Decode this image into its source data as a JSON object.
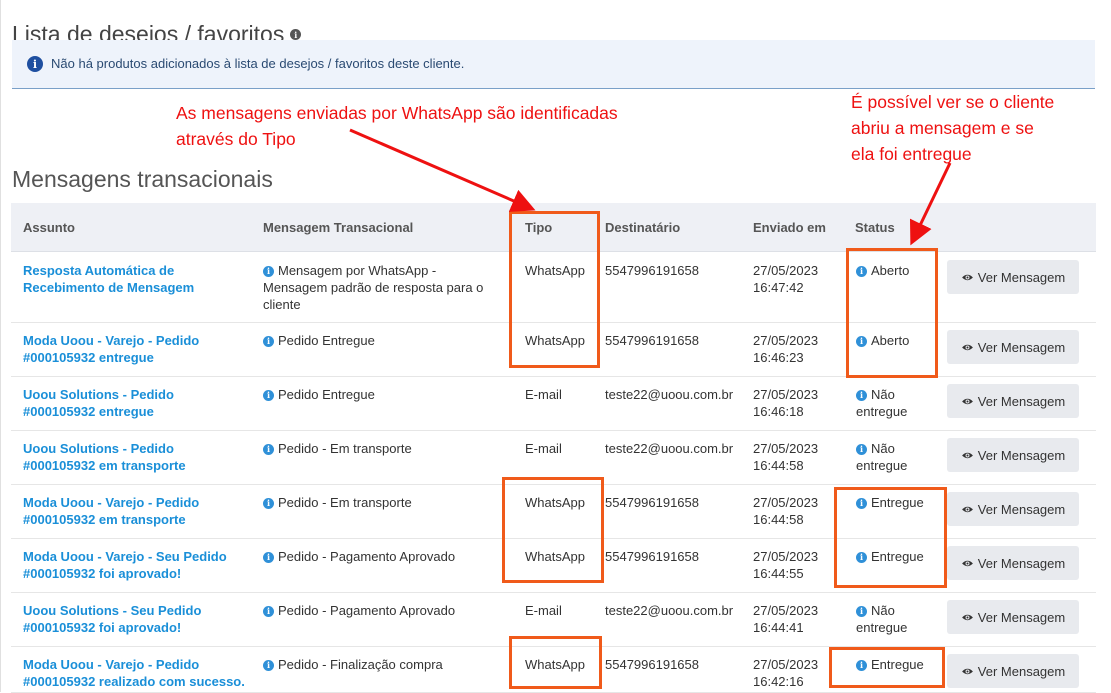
{
  "wishlist": {
    "title": "Lista de desejos / favoritos",
    "help_icon": "info-icon",
    "alert_icon": "info-circle-icon",
    "alert_text": "Não há produtos adicionados à lista de desejos / favoritos deste cliente."
  },
  "annotations": {
    "left": "As mensagens enviadas por WhatsApp são identificadas\natravés do Tipo",
    "right": "É possível ver se o cliente\nabriu a mensagem e se\nela foi entregue",
    "color": "#ee1111",
    "highlight_color": "#f05a1a"
  },
  "messages": {
    "title": "Mensagens transacionais",
    "columns": {
      "assunto": "Assunto",
      "mensagem": "Mensagem Transacional",
      "tipo": "Tipo",
      "destinatario": "Destinatário",
      "enviado": "Enviado em",
      "status": "Status"
    },
    "button_label": "Ver Mensagem",
    "button_icon": "eye-icon",
    "rows": [
      {
        "assunto": "Resposta Automática de\nRecebimento de Mensagem",
        "mensagem": "Mensagem por WhatsApp -\nMensagem padrão de resposta para o\ncliente",
        "tipo": "WhatsApp",
        "destinatario": "5547996191658",
        "enviado": "27/05/2023\n16:47:42",
        "status": "Aberto"
      },
      {
        "assunto": "Moda Uoou - Varejo - Pedido\n#000105932 entregue",
        "mensagem": "Pedido Entregue",
        "tipo": "WhatsApp",
        "destinatario": "5547996191658",
        "enviado": "27/05/2023\n16:46:23",
        "status": "Aberto"
      },
      {
        "assunto": "Uoou Solutions - Pedido\n#000105932 entregue",
        "mensagem": "Pedido Entregue",
        "tipo": "E-mail",
        "destinatario": "teste22@uoou.com.br",
        "enviado": "27/05/2023\n16:46:18",
        "status": "Não\nentregue"
      },
      {
        "assunto": "Uoou Solutions - Pedido\n#000105932 em transporte",
        "mensagem": "Pedido - Em transporte",
        "tipo": "E-mail",
        "destinatario": "teste22@uoou.com.br",
        "enviado": "27/05/2023\n16:44:58",
        "status": "Não\nentregue"
      },
      {
        "assunto": "Moda Uoou - Varejo - Pedido\n#000105932 em transporte",
        "mensagem": "Pedido - Em transporte",
        "tipo": "WhatsApp",
        "destinatario": "5547996191658",
        "enviado": "27/05/2023\n16:44:58",
        "status": "Entregue"
      },
      {
        "assunto": "Moda Uoou - Varejo - Seu Pedido\n#000105932 foi aprovado!",
        "mensagem": "Pedido - Pagamento Aprovado",
        "tipo": "WhatsApp",
        "destinatario": "5547996191658",
        "enviado": "27/05/2023\n16:44:55",
        "status": "Entregue"
      },
      {
        "assunto": "Uoou Solutions - Seu Pedido\n#000105932 foi aprovado!",
        "mensagem": "Pedido - Pagamento Aprovado",
        "tipo": "E-mail",
        "destinatario": "teste22@uoou.com.br",
        "enviado": "27/05/2023\n16:44:41",
        "status": "Não\nentregue"
      },
      {
        "assunto": "Moda Uoou - Varejo - Pedido\n#000105932 realizado com sucesso.",
        "mensagem": "Pedido - Finalização compra",
        "tipo": "WhatsApp",
        "destinatario": "5547996191658",
        "enviado": "27/05/2023\n16:42:16",
        "status": "Entregue"
      }
    ]
  }
}
